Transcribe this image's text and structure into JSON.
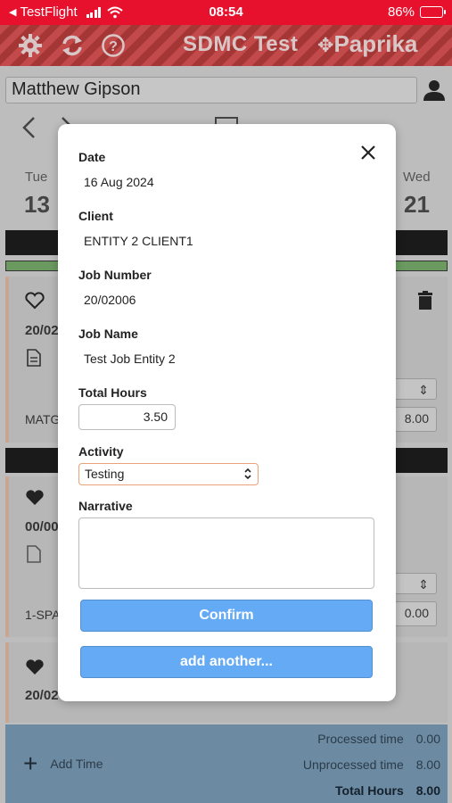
{
  "status_bar": {
    "carrier": "TestFlight",
    "time": "08:54",
    "battery": "86%",
    "battery_level": 0.86
  },
  "header": {
    "title": "SDMC Test",
    "brand": "Paprika"
  },
  "background": {
    "user_name": "Matthew Gipson",
    "days": [
      {
        "name": "Tue",
        "num": "13"
      },
      {
        "name": "Wed",
        "num": "21"
      }
    ],
    "card1": {
      "job": "20/02",
      "code": "MATG",
      "hours": "8.00"
    },
    "card2": {
      "job": "00/00",
      "code": "1-SPAN",
      "hours": "0.00"
    },
    "card3": {
      "job": "20/02"
    },
    "footer": {
      "add_time": "Add Time",
      "processed_label": "Processed time",
      "processed_value": "0.00",
      "unprocessed_label": "Unprocessed time",
      "unprocessed_value": "8.00",
      "total_label": "Total Hours",
      "total_value": "8.00"
    }
  },
  "modal": {
    "date_label": "Date",
    "date_value": "16 Aug 2024",
    "client_label": "Client",
    "client_value": "ENTITY 2 CLIENT1",
    "job_number_label": "Job Number",
    "job_number_value": "20/02006",
    "job_name_label": "Job Name",
    "job_name_value": "Test Job Entity 2",
    "total_hours_label": "Total Hours",
    "total_hours_value": "3.50",
    "activity_label": "Activity",
    "activity_value": "Testing",
    "narrative_label": "Narrative",
    "narrative_value": "",
    "confirm_label": "Confirm",
    "add_another_label": "add another..."
  }
}
